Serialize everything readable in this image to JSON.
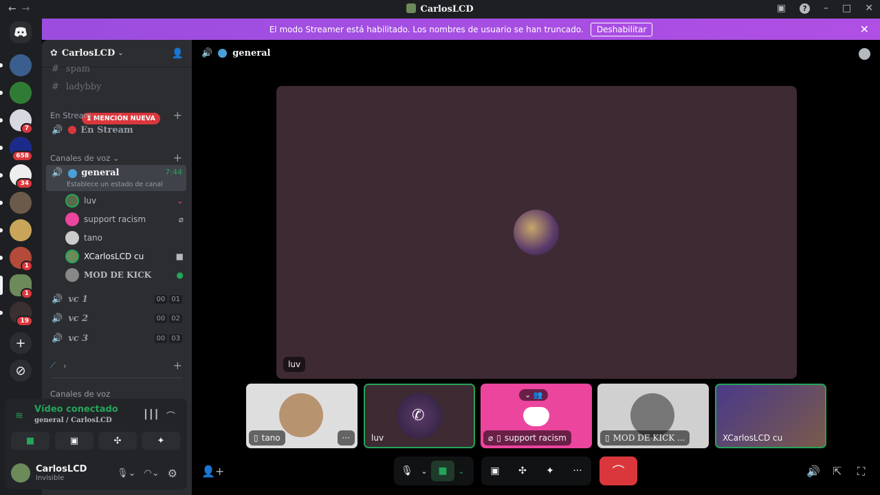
{
  "titlebar": {
    "title": "CarlosLCD",
    "nav_back": "←",
    "nav_fwd": "→"
  },
  "banner": {
    "text": "El modo Streamer está habilitado. Los nombres de usuario se han truncado.",
    "button": "Deshabilitar"
  },
  "rail": {
    "badges": [
      "7",
      "658",
      "34",
      "1",
      "1",
      "19"
    ]
  },
  "server": {
    "name": "CarlosLCD"
  },
  "channels": {
    "spam": "spam",
    "ladybug": "ladybby",
    "mention": "1 MENCIÓN NUEVA",
    "cat_stream": "En Stream",
    "en_stream": "En Stream",
    "cat_voice": "Canales de voz",
    "general": "general",
    "general_time": "7:44",
    "general_status": "Establece un estado de canal",
    "vc1": "vc 1",
    "vc1_a": "00",
    "vc1_b": "01",
    "vc2": "vc 2",
    "vc2_a": "00",
    "vc2_b": "02",
    "vc3": "vc 3",
    "vc3_a": "00",
    "vc3_b": "03",
    "cat_voice2": "Canales de voz"
  },
  "members": [
    {
      "name": "luv"
    },
    {
      "name": "support racism"
    },
    {
      "name": "tano"
    },
    {
      "name": "XCarlosLCD cu"
    },
    {
      "name": "MOD DE KICK"
    }
  ],
  "voice": {
    "status": "Vídeo conectado",
    "location": "general / CarlosLCD"
  },
  "user": {
    "name": "CarlosLCD",
    "status": "Invisible"
  },
  "main": {
    "channel": "general",
    "stage_label": "luv"
  },
  "tiles": [
    {
      "label": "tano"
    },
    {
      "label": "luv"
    },
    {
      "label": "support racism"
    },
    {
      "label": "MOD DE KICK ..."
    },
    {
      "label": "XCarlosLCD cu"
    }
  ],
  "colors": {
    "accent": "#a64fe8",
    "green": "#23a55a",
    "red": "#da373c",
    "pink": "#eb459e"
  }
}
